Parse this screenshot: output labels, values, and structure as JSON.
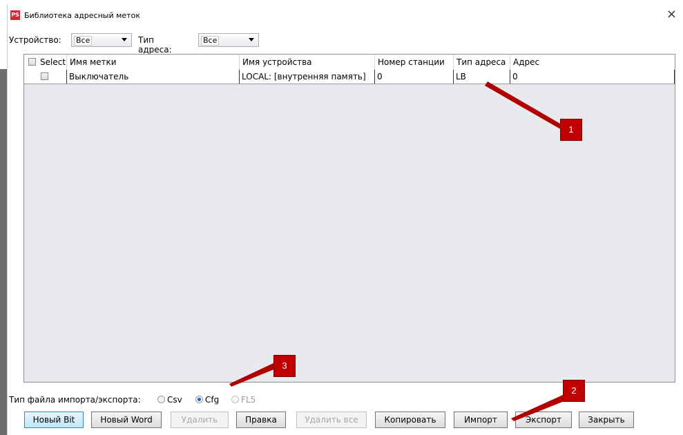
{
  "window": {
    "title": "Библиотека адресный меток",
    "logo_text": "PS",
    "close_glyph": "×"
  },
  "filters": {
    "device_label": "Устройство:",
    "device_value": "Все",
    "address_type_label": "Тип адреса:",
    "address_type_value": "Все"
  },
  "table": {
    "columns": [
      "Select",
      "Имя метки",
      "Имя устройства",
      "Номер станции",
      "Тип адреса",
      "Адрес"
    ],
    "rows": [
      {
        "selected": false,
        "tag_name": "Выключатель",
        "device_name": "LOCAL: [внутренняя память]",
        "station": "0",
        "address_type": "LB",
        "address": "0"
      }
    ]
  },
  "file_type": {
    "label": "Тип файла импорта/экспорта:",
    "options": [
      {
        "label": "Csv",
        "selected": false,
        "enabled": true
      },
      {
        "label": "Cfg",
        "selected": true,
        "enabled": true
      },
      {
        "label": "FL5",
        "selected": false,
        "enabled": false
      }
    ]
  },
  "buttons": {
    "new_bit": "Новый Bit",
    "new_word": "Новый Word",
    "delete": "Удалить",
    "edit": "Правка",
    "delete_all": "Удалить все",
    "copy": "Копировать",
    "import": "Импорт",
    "export": "Экспорт",
    "close": "Закрыть"
  },
  "callouts": [
    "1",
    "2",
    "3"
  ],
  "colors": {
    "callout": "#c00000",
    "logo": "#d7262c",
    "radio_dot": "#1e5fbf"
  }
}
